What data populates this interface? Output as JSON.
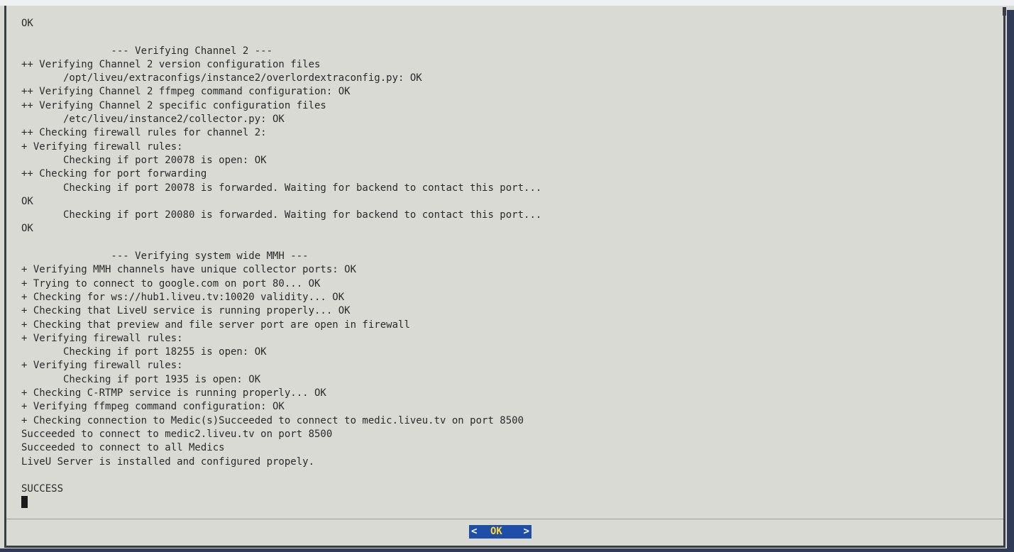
{
  "terminal": {
    "lines": [
      "OK",
      "",
      "               --- Verifying Channel 2 ---",
      "++ Verifying Channel 2 version configuration files",
      "       /opt/liveu/extraconfigs/instance2/overlordextraconfig.py: OK",
      "++ Verifying Channel 2 ffmpeg command configuration: OK",
      "++ Verifying Channel 2 specific configuration files",
      "       /etc/liveu/instance2/collector.py: OK",
      "++ Checking firewall rules for channel 2:",
      "+ Verifying firewall rules:",
      "       Checking if port 20078 is open: OK",
      "++ Checking for port forwarding",
      "       Checking if port 20078 is forwarded. Waiting for backend to contact this port...",
      "OK",
      "       Checking if port 20080 is forwarded. Waiting for backend to contact this port...",
      "OK",
      "",
      "               --- Verifying system wide MMH ---",
      "+ Verifying MMH channels have unique collector ports: OK",
      "+ Trying to connect to google.com on port 80... OK",
      "+ Checking for ws://hub1.liveu.tv:10020 validity... OK",
      "+ Checking that LiveU service is running properly... OK",
      "+ Checking that preview and file server port are open in firewall",
      "+ Verifying firewall rules:",
      "       Checking if port 18255 is open: OK",
      "+ Verifying firewall rules:",
      "       Checking if port 1935 is open: OK",
      "+ Checking C-RTMP service is running properly... OK",
      "+ Verifying ffmpeg command configuration: OK",
      "+ Checking connection to Medic(s)Succeeded to connect to medic.liveu.tv on port 8500",
      "Succeeded to connect to medic2.liveu.tv on port 8500",
      "Succeeded to connect to all Medics",
      "LiveU Server is installed and configured propely.",
      "",
      "SUCCESS"
    ]
  },
  "dialog": {
    "ok_bracket_left": "<",
    "ok_label": "OK",
    "ok_bracket_right": ">"
  },
  "colors": {
    "background": "#d9dad4",
    "text": "#2a2a2a",
    "button_bg": "#1f4ea8",
    "button_label": "#ffd930",
    "button_bracket": "#ffffff",
    "frame": "#3a3d45"
  }
}
